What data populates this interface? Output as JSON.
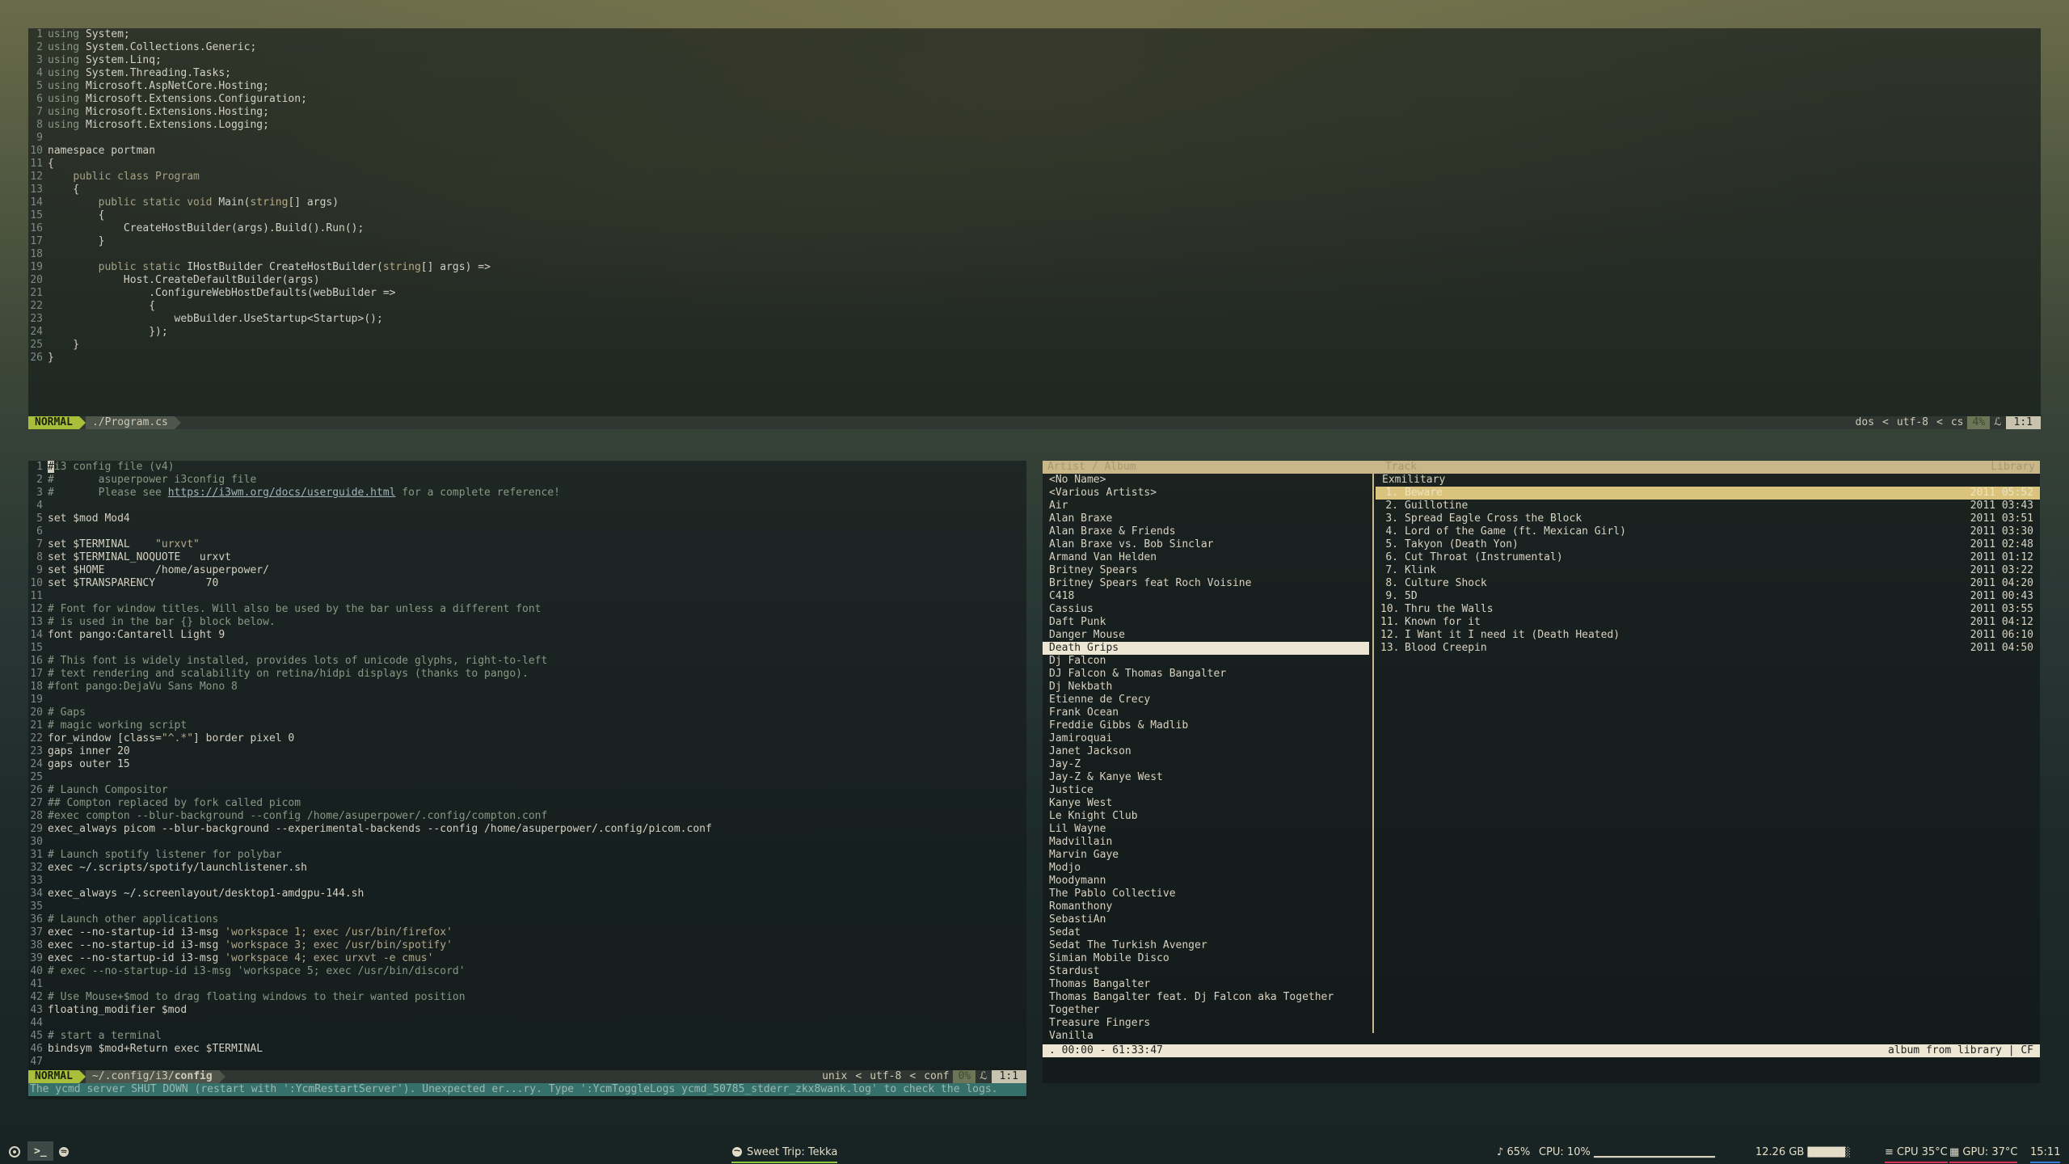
{
  "top_editor": {
    "lines": [
      [
        {
          "c": "cm",
          "t": "using"
        },
        {
          "t": " System;"
        }
      ],
      [
        {
          "c": "cm",
          "t": "using"
        },
        {
          "t": " System.Collections.Generic;"
        }
      ],
      [
        {
          "c": "cm",
          "t": "using"
        },
        {
          "t": " System.Linq;"
        }
      ],
      [
        {
          "c": "cm",
          "t": "using"
        },
        {
          "t": " System.Threading.Tasks;"
        }
      ],
      [
        {
          "c": "cm",
          "t": "using"
        },
        {
          "t": " Microsoft.AspNetCore.Hosting;"
        }
      ],
      [
        {
          "c": "cm",
          "t": "using"
        },
        {
          "t": " Microsoft.Extensions.Configuration;"
        }
      ],
      [
        {
          "c": "cm",
          "t": "using"
        },
        {
          "t": " Microsoft.Extensions.Hosting;"
        }
      ],
      [
        {
          "c": "cm",
          "t": "using"
        },
        {
          "t": " Microsoft.Extensions.Logging;"
        }
      ],
      [],
      [
        {
          "t": "namespace portman"
        }
      ],
      [
        {
          "t": "{"
        }
      ],
      [
        {
          "t": "    "
        },
        {
          "c": "kw",
          "t": "public class Program"
        }
      ],
      [
        {
          "t": "    {"
        }
      ],
      [
        {
          "t": "        "
        },
        {
          "c": "kw",
          "t": "public static void"
        },
        {
          "t": " Main("
        },
        {
          "c": "tp",
          "t": "string"
        },
        {
          "t": "[] args)"
        }
      ],
      [
        {
          "t": "        {"
        }
      ],
      [
        {
          "t": "            CreateHostBuilder(args).Build().Run();"
        }
      ],
      [
        {
          "t": "        }"
        }
      ],
      [],
      [
        {
          "t": "        "
        },
        {
          "c": "kw",
          "t": "public static"
        },
        {
          "t": " IHostBuilder CreateHostBuilder("
        },
        {
          "c": "tp",
          "t": "string"
        },
        {
          "t": "[] args) =>"
        }
      ],
      [
        {
          "t": "            Host.CreateDefaultBuilder(args)"
        }
      ],
      [
        {
          "t": "                .ConfigureWebHostDefaults(webBuilder =>"
        }
      ],
      [
        {
          "t": "                {"
        }
      ],
      [
        {
          "t": "                    webBuilder.UseStartup<Startup>();"
        }
      ],
      [
        {
          "t": "                });"
        }
      ],
      [
        {
          "t": "    }"
        }
      ],
      [
        {
          "t": "}"
        }
      ]
    ],
    "status": {
      "mode": "NORMAL",
      "file": "./Program.cs",
      "format": "dos",
      "encoding": "utf-8",
      "filetype": "cs",
      "percent": "4%",
      "ln_icon": "ℒ",
      "position": "1:1"
    }
  },
  "bottom_editor": {
    "lines": [
      [
        {
          "c": "cm",
          "t": "i3 config file (v4)"
        }
      ],
      [
        {
          "c": "cm",
          "t": "#       asuperpower i3config file"
        }
      ],
      [
        {
          "c": "cm",
          "t": "#       Please see "
        },
        {
          "c": "ul",
          "t": "https://i3wm.org/docs/userguide.html"
        },
        {
          "c": "cm",
          "t": " for a complete reference!"
        }
      ],
      [],
      [
        {
          "t": "set $mod Mod4"
        }
      ],
      [],
      [
        {
          "t": "set $TERMINAL    "
        },
        {
          "c": "st",
          "t": "\"urxvt\""
        }
      ],
      [
        {
          "t": "set $TERMINAL_NOQUOTE   urxvt"
        }
      ],
      [
        {
          "t": "set $HOME        /home/asuperpower/"
        }
      ],
      [
        {
          "t": "set $TRANSPARENCY        70"
        }
      ],
      [],
      [
        {
          "c": "cm",
          "t": "# Font for window titles. Will also be used by the bar unless a different font"
        }
      ],
      [
        {
          "c": "cm",
          "t": "# is used in the bar {} block below."
        }
      ],
      [
        {
          "t": "font pango:Cantarell Light 9"
        }
      ],
      [],
      [
        {
          "c": "cm",
          "t": "# This font is widely installed, provides lots of unicode glyphs, right-to-left"
        }
      ],
      [
        {
          "c": "cm",
          "t": "# text rendering and scalability on retina/hidpi displays (thanks to pango)."
        }
      ],
      [
        {
          "c": "cm",
          "t": "#font pango:DejaVu Sans Mono 8"
        }
      ],
      [],
      [
        {
          "c": "cm",
          "t": "# Gaps"
        }
      ],
      [
        {
          "c": "cm",
          "t": "# magic working script"
        }
      ],
      [
        {
          "t": "for_window [class="
        },
        {
          "c": "st",
          "t": "\"^.*\""
        },
        {
          "t": "] border pixel 0"
        }
      ],
      [
        {
          "t": "gaps inner 20"
        }
      ],
      [
        {
          "t": "gaps outer 15"
        }
      ],
      [],
      [
        {
          "c": "cm",
          "t": "# Launch Compositor"
        }
      ],
      [
        {
          "c": "cm",
          "t": "## Compton replaced by fork called picom"
        }
      ],
      [
        {
          "c": "cm",
          "t": "#exec compton --blur-background --config /home/asuperpower/.config/compton.conf"
        }
      ],
      [
        {
          "t": "exec_always picom --blur-background --experimental-backends --config /home/asuperpower/.config/picom.conf"
        }
      ],
      [],
      [
        {
          "c": "cm",
          "t": "# Launch spotify listener for polybar"
        }
      ],
      [
        {
          "t": "exec ~/.scripts/spotify/launchlistener.sh"
        }
      ],
      [],
      [
        {
          "t": "exec_always ~/.screenlayout/desktop1-amdgpu-144.sh"
        }
      ],
      [],
      [
        {
          "c": "cm",
          "t": "# Launch other applications"
        }
      ],
      [
        {
          "t": "exec --no-startup-id i3-msg "
        },
        {
          "c": "st",
          "t": "'workspace 1; exec /usr/bin/firefox'"
        }
      ],
      [
        {
          "t": "exec --no-startup-id i3-msg "
        },
        {
          "c": "st",
          "t": "'workspace 3; exec /usr/bin/spotify'"
        }
      ],
      [
        {
          "t": "exec --no-startup-id i3-msg "
        },
        {
          "c": "st",
          "t": "'workspace 4; exec urxvt -e cmus'"
        }
      ],
      [
        {
          "c": "cm",
          "t": "# exec --no-startup-id i3-msg 'workspace 5; exec /usr/bin/discord'"
        }
      ],
      [],
      [
        {
          "c": "cm",
          "t": "# Use Mouse+$mod to drag floating windows to their wanted position"
        }
      ],
      [
        {
          "t": "floating_modifier $mod"
        }
      ],
      [],
      [
        {
          "c": "cm",
          "t": "# start a terminal"
        }
      ],
      [
        {
          "t": "bindsym $mod+Return exec $TERMINAL"
        }
      ],
      []
    ],
    "status": {
      "mode": "NORMAL",
      "file": "~/.config/i3/",
      "file_bold": "config",
      "format": "unix",
      "encoding": "utf-8",
      "filetype": "conf",
      "percent": "0%",
      "ln_icon": "ℒ",
      "position": "1:1"
    },
    "message": "The ycmd server SHUT DOWN (restart with ':YcmRestartServer'). Unexpected er...ry. Type ':YcmToggleLogs ycmd_50785_stderr_zkx8wank.log' to check the logs."
  },
  "cmus": {
    "header_left": "Artist / Album",
    "header_mid": "Track",
    "header_right": "Library",
    "artists": [
      "<No Name>",
      "<Various Artists>",
      "Air",
      "Alan Braxe",
      "Alan Braxe & Friends",
      "Alan Braxe vs. Bob Sinclar",
      "Armand Van Helden",
      "Britney Spears",
      "Britney Spears feat Roch Voisine",
      "C418",
      "Cassius",
      "Daft Punk",
      "Danger Mouse",
      "Death Grips",
      "Dj Falcon",
      "DJ Falcon & Thomas Bangalter",
      "Dj Nekbath",
      "Etienne de Crecy",
      "Frank Ocean",
      "Freddie Gibbs & Madlib",
      "Jamiroquai",
      "Janet Jackson",
      "Jay-Z",
      "Jay-Z & Kanye West",
      "Justice",
      "Kanye West",
      "Le Knight Club",
      "Lil Wayne",
      "Madvillain",
      "Marvin Gaye",
      "Modjo",
      "Moodymann",
      "The Pablo Collective",
      "Romanthony",
      "SebastiAn",
      "Sedat",
      "Sedat The Turkish Avenger",
      "Simian Mobile Disco",
      "Stardust",
      "Thomas Bangalter",
      "Thomas Bangalter feat. Dj Falcon aka Together",
      "Together",
      "Treasure Fingers",
      "Vanilla"
    ],
    "selected_artist": 13,
    "album": "Exmilitary",
    "tracks": [
      {
        "n": "1.",
        "title": "Beware",
        "meta": "2011 05:52"
      },
      {
        "n": "2.",
        "title": "Guillotine",
        "meta": "2011 03:43"
      },
      {
        "n": "3.",
        "title": "Spread Eagle Cross the Block",
        "meta": "2011 03:51"
      },
      {
        "n": "4.",
        "title": "Lord of the Game (ft. Mexican Girl)",
        "meta": "2011 03:30"
      },
      {
        "n": "5.",
        "title": "Takyon (Death Yon)",
        "meta": "2011 02:48"
      },
      {
        "n": "6.",
        "title": "Cut Throat (Instrumental)",
        "meta": "2011 01:12"
      },
      {
        "n": "7.",
        "title": "Klink",
        "meta": "2011 03:22"
      },
      {
        "n": "8.",
        "title": "Culture Shock",
        "meta": "2011 04:20"
      },
      {
        "n": "9.",
        "title": "5D",
        "meta": "2011 00:43"
      },
      {
        "n": "10.",
        "title": "Thru the Walls",
        "meta": "2011 03:55"
      },
      {
        "n": "11.",
        "title": "Known for it",
        "meta": "2011 04:12"
      },
      {
        "n": "12.",
        "title": "I Want it I need it (Death Heated)",
        "meta": "2011 06:10"
      },
      {
        "n": "13.",
        "title": "Blood Creepin",
        "meta": "2011 04:50"
      }
    ],
    "selected_track": 0,
    "status_left": ". 00:00 - 61:33:47",
    "status_right": "album from library | CF"
  },
  "polybar": {
    "now_playing": "Sweet Trip: Tekka",
    "volume": "65%",
    "cpu": "CPU: 10% ▁▁▁▁▁▁▁▁▁▁▁▁▁▁▁",
    "memory": "12.26 GB",
    "memory_bar": "███████░",
    "cpu_temp": "CPU 35°C",
    "gpu_temp": "GPU: 37°C",
    "time": "15:11",
    "colors": {
      "cpu_temp": "#e0315a",
      "gpu_temp": "#e0315a",
      "time": "#3a7bd5",
      "now_playing": "#8cc63f"
    }
  }
}
